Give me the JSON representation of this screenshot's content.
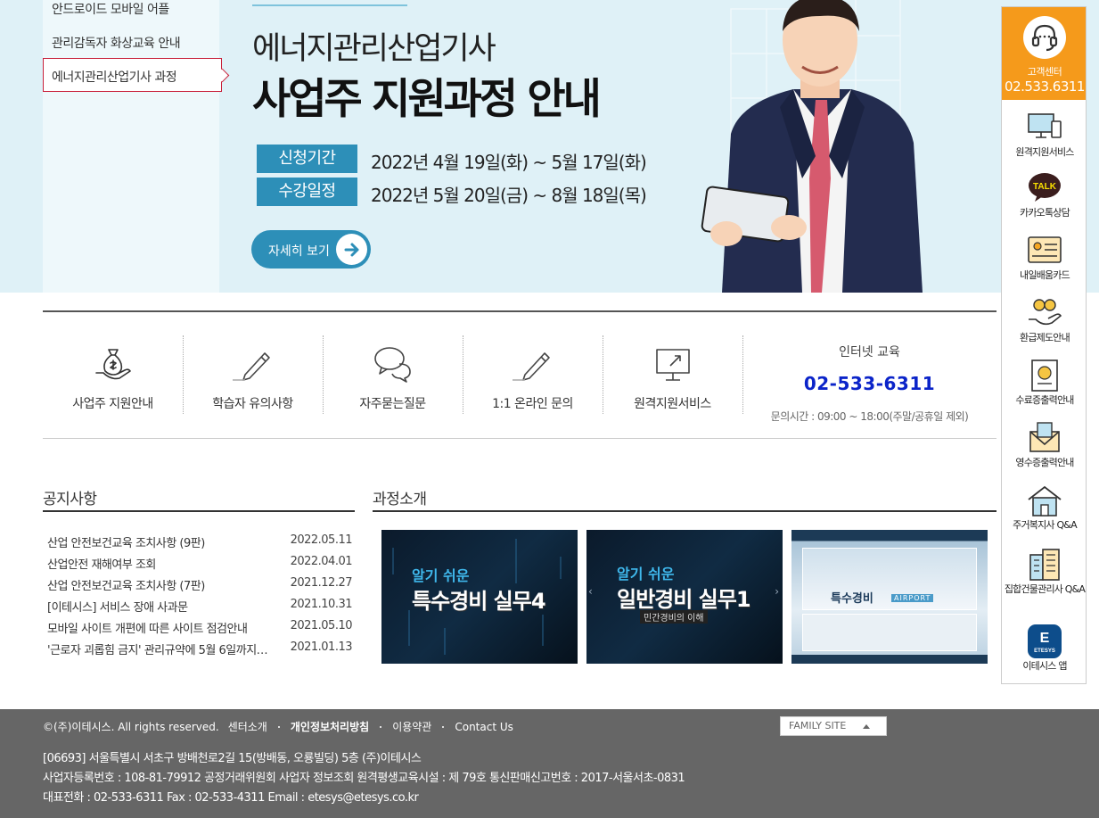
{
  "sidenav": {
    "items": [
      "안드로이드 모바일 어플",
      "관리감독자 화상교육 안내",
      "에너지관리산업기사 과정"
    ]
  },
  "hero": {
    "subtitle": "에너지관리산업기사",
    "title": "사업주 지원과정 안내",
    "rows": [
      {
        "tag": "신청기간",
        "date": "2022년 4월 19일(화) ~ 5월 17일(화)"
      },
      {
        "tag": "수강일정",
        "date": "2022년 5월 20일(금) ~ 8월 18일(목)"
      }
    ],
    "button_label": "자세히 보기"
  },
  "quick_menu": {
    "items": [
      {
        "label": "사업주 지원안내",
        "icon": "money-bag-hand-icon"
      },
      {
        "label": "학습자 유의사항",
        "icon": "pencil-icon"
      },
      {
        "label": "자주묻는질문",
        "icon": "speech-bubbles-icon"
      },
      {
        "label": "1:1 온라인 문의",
        "icon": "pencil-icon"
      },
      {
        "label": "원격지원서비스",
        "icon": "monitor-icon"
      }
    ],
    "contact": {
      "title": "인터넷 교육",
      "phone": "02-533-6311",
      "hours": "문의시간 : 09:00 ~ 18:00(주말/공휴일 제외)"
    }
  },
  "notice": {
    "title": "공지사항",
    "rows": [
      {
        "title": "산업 안전보건교육 조치사항 (9판)",
        "date": "2022.05.11"
      },
      {
        "title": "산업안전 재해여부 조회",
        "date": "2022.04.01"
      },
      {
        "title": "산업 안전보건교육 조치사항 (7판)",
        "date": "2021.12.27"
      },
      {
        "title": "[이테시스] 서비스 장애 사과문",
        "date": "2021.10.31"
      },
      {
        "title": "모바일 사이트 개편에 따른 사이트 점검안내",
        "date": "2021.05.10"
      },
      {
        "title": "'근로자 괴롭힘 금지' 관리규약에 5월 6일까지…",
        "date": "2021.01.13"
      }
    ]
  },
  "courses": {
    "title": "과정소개",
    "items": [
      {
        "small": "알기 쉬운",
        "big": "특수경비 실무4"
      },
      {
        "small": "알기 쉬운",
        "big": "일반경비 실무1",
        "sub": "민간경비의 이해"
      },
      {
        "big": "특수경비",
        "tag": "AIRPORT"
      }
    ]
  },
  "footer": {
    "copyright": "©(주)이테시스. All rights reserved.",
    "links": [
      "센터소개",
      "개인정보처리방침",
      "이용약관",
      "Contact Us"
    ],
    "family_site": "FAMILY SITE",
    "address": "[06693] 서울특별시 서초구 방배천로2길 15(방배동, 오룡빌딩) 5층 (주)이테시스",
    "business": "사업자등록번호 : 108-81-79912 공정거래위원회 사업자 정보조회  원격평생교육시설 : 제 79호  통신판매신고번호 : 2017-서울서초-0831",
    "contact": "대표전화 : 02-533-6311 Fax : 02-533-4311 Email : etesys@etesys.co.kr"
  },
  "right_bar": {
    "call_center_label": "고객센터",
    "call_center_phone": "02.533.6311",
    "items": [
      {
        "label": "원격지원서비스",
        "icon": "remote-pc-icon"
      },
      {
        "label": "카카오톡상담",
        "icon": "kakaotalk-icon"
      },
      {
        "label": "내일배움카드",
        "icon": "card-icon"
      },
      {
        "label": "환급제도안내",
        "icon": "refund-coins-icon"
      },
      {
        "label": "수료증출력안내",
        "icon": "certificate-icon"
      },
      {
        "label": "영수증출력안내",
        "icon": "receipt-envelope-icon"
      },
      {
        "label": "주거복지사 Q&A",
        "icon": "house-icon"
      },
      {
        "label": "집합건물관리사 Q&A",
        "icon": "building-icon"
      },
      {
        "label": "이테시스 앱",
        "icon": "etesys-app-icon"
      }
    ],
    "kakao_badge": "TALK",
    "etesys_badge": "ETESYS"
  },
  "colors": {
    "hero_bg": "#dff1f7",
    "accent_blue": "#2d8fb8",
    "call_center_orange": "#f59a1b",
    "phone_blue": "#0b24c9",
    "footer_bg": "#666666"
  }
}
